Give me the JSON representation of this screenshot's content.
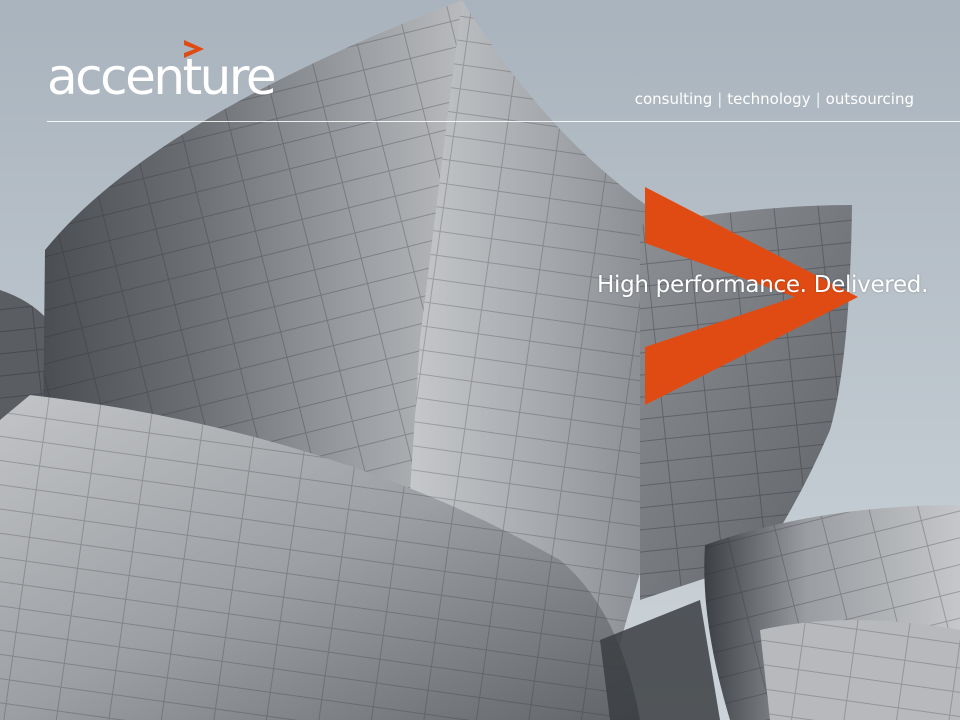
{
  "brand": {
    "logo_text": "accenture",
    "accent_color": "#e04b14",
    "tagline_parts": [
      "consulting",
      "technology",
      "outsourcing"
    ],
    "separator": "|"
  },
  "slide": {
    "slogan": "High performance. Delivered."
  }
}
